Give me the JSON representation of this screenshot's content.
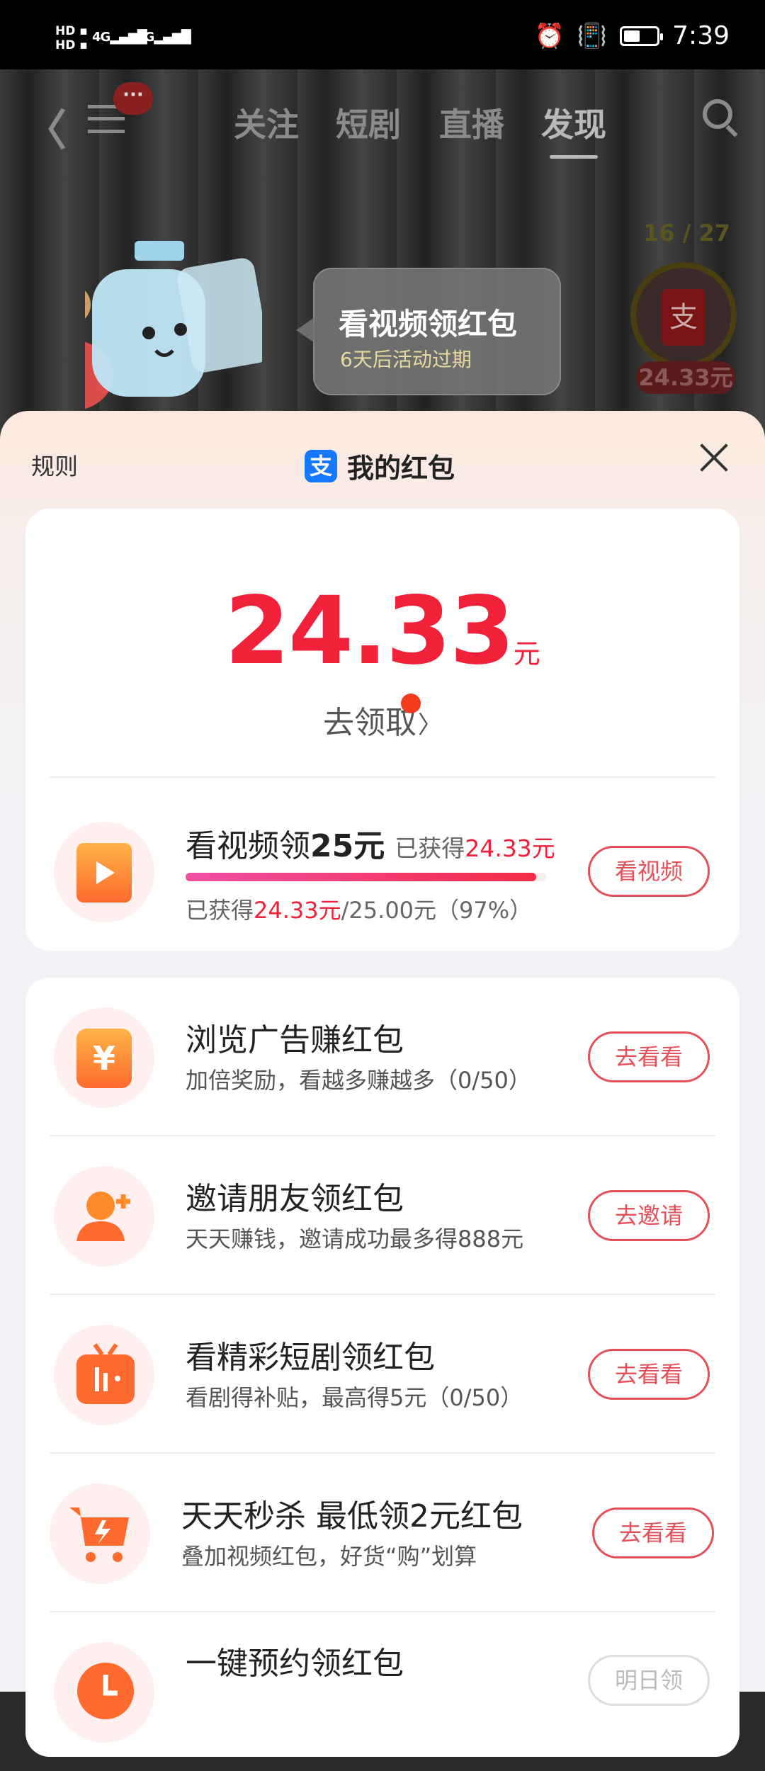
{
  "status_bar": {
    "sim1": "HD",
    "sim2": "HD",
    "net1": "4G",
    "net2": "4G",
    "time": "7:39"
  },
  "nav": {
    "tabs": [
      "关注",
      "短剧",
      "直播",
      "发现"
    ],
    "active_tab": "发现",
    "badge": "···"
  },
  "video": {
    "counter": "16 / 27",
    "red_packet_amount": "24.33元",
    "bubble_title": "看视频领红包",
    "bubble_sub": "6天后活动过期"
  },
  "sheet": {
    "rules_label": "规则",
    "title": "我的红包",
    "alipay_glyph": "支",
    "amount": "24.33",
    "amount_unit": "元",
    "claim_label": "去领取",
    "claim_arrow": "〉"
  },
  "featured_task": {
    "title_prefix": "看视频领",
    "title_amount": "25元",
    "earned_label": "已获得",
    "earned_amount": "24.33元",
    "progress_prefix": "已获得",
    "progress_value": "24.33元",
    "progress_rest": "/25.00元（97%）",
    "progress": 0.97,
    "button": "看视频"
  },
  "tasks": [
    {
      "title": "浏览广告赚红包",
      "desc": "加倍奖励，看越多赚越多（0/50）",
      "button": "去看看",
      "glyph": "¥"
    },
    {
      "title": "邀请朋友领红包",
      "desc": "天天赚钱，邀请成功最多得888元",
      "button": "去邀请",
      "glyph": ""
    },
    {
      "title": "看精彩短剧领红包",
      "desc": "看剧得补贴，最高得5元（0/50）",
      "button": "去看看",
      "glyph": ""
    },
    {
      "title": "天天秒杀 最低领2元红包",
      "desc": "叠加视频红包，好货“购”划算",
      "button": "去看看",
      "glyph": ""
    },
    {
      "title": "一键预约领红包",
      "desc": "",
      "button": "明日领",
      "glyph": ""
    }
  ],
  "colors": {
    "accent": "#f1213a",
    "button_border": "#e4505a",
    "alipay": "#1677ff"
  }
}
